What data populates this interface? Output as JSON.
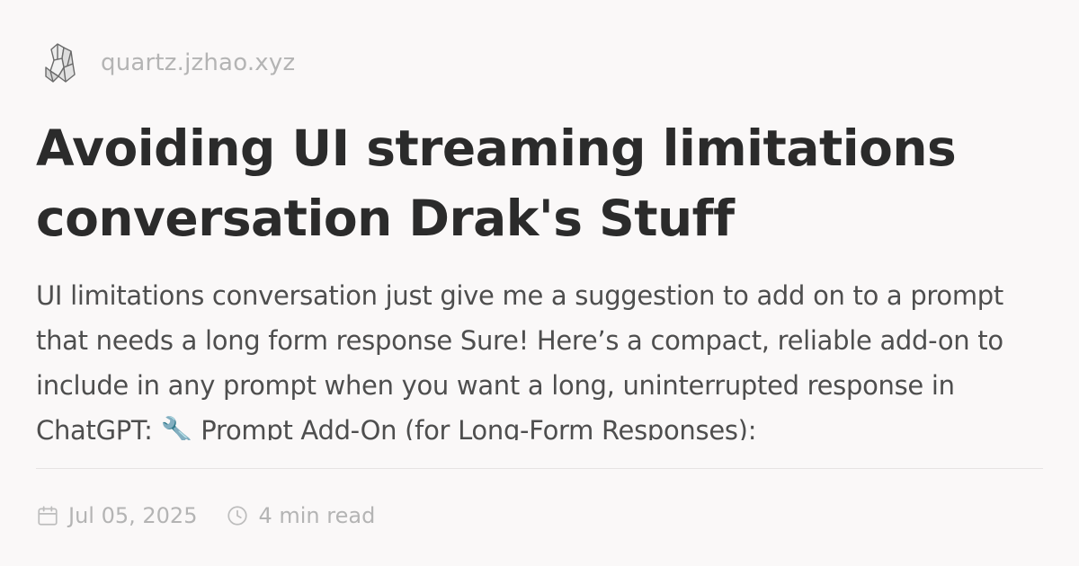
{
  "site": {
    "name": "quartz.jzhao.xyz",
    "logo_icon": "crystal-logo-icon"
  },
  "article": {
    "title": "Avoiding UI streaming limitations conversation Drak's Stuff",
    "summary": "UI limitations conversation just give me a suggestion to add on to a prompt that needs a long form response Sure! Here’s a compact, reliable add-on to include in any prompt when you want a long, uninterrupted response in ChatGPT: 🔧 Prompt Add-On (for Long-Form Responses):",
    "date": "Jul 05, 2025",
    "reading_time": "4 min read",
    "date_icon": "calendar-icon",
    "reading_time_icon": "clock-icon"
  },
  "colors": {
    "background": "#faf8f8",
    "title": "#2b2b2b",
    "body_text": "#4e4e4e",
    "muted": "#b4b4b4",
    "divider": "#e6e3e3"
  }
}
